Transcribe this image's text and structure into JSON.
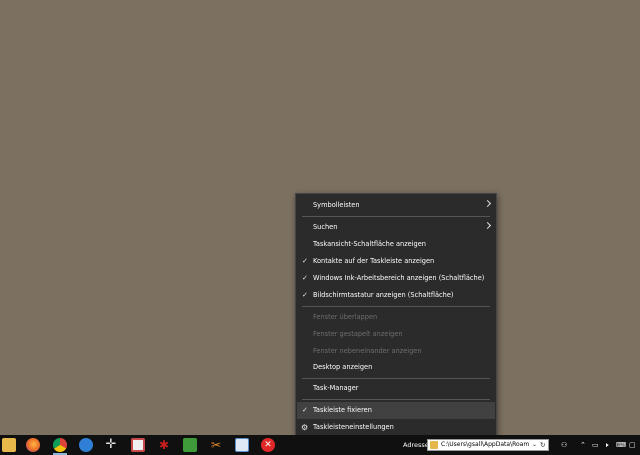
{
  "desktop": {
    "background_color": "#7c7060"
  },
  "context_menu": {
    "items": [
      {
        "label": "Symbolleisten",
        "submenu": true
      },
      {
        "label": "Suchen",
        "submenu": true
      },
      {
        "label": "Taskansicht-Schaltfläche anzeigen"
      },
      {
        "label": "Kontakte auf der Taskleiste anzeigen",
        "checked": true
      },
      {
        "label": "Windows Ink-Arbeitsbereich anzeigen (Schaltfläche)",
        "checked": true
      },
      {
        "label": "Bildschirmtastatur anzeigen (Schaltfläche)",
        "checked": true
      },
      {
        "label": "Fenster überlappen",
        "disabled": true
      },
      {
        "label": "Fenster gestapelt anzeigen",
        "disabled": true
      },
      {
        "label": "Fenster nebeneinander anzeigen",
        "disabled": true
      },
      {
        "label": "Desktop anzeigen"
      },
      {
        "label": "Task-Manager"
      },
      {
        "label": "Taskleiste fixieren",
        "checked": true,
        "highlighted": true
      },
      {
        "label": "Taskleisteneinstellungen",
        "icon": "gear-icon"
      }
    ]
  },
  "taskbar": {
    "pinned_icons": [
      {
        "name": "file-explorer-icon",
        "color": "#e8b84a"
      },
      {
        "name": "firefox-icon",
        "color": "#e86a2a"
      },
      {
        "name": "chrome-icon",
        "color": "#3aa35a"
      },
      {
        "name": "edge-icon",
        "color": "#2f7fd6"
      },
      {
        "name": "move-cross-icon",
        "color": "#e0e0e0"
      },
      {
        "name": "app-window-icon",
        "color": "#c94a4a"
      },
      {
        "name": "red-bug-icon",
        "color": "#c81e1e"
      },
      {
        "name": "green-document-icon",
        "color": "#3f9a3a"
      },
      {
        "name": "orange-scissors-icon",
        "color": "#e28a2a"
      },
      {
        "name": "text-document-icon",
        "color": "#5a8fd0"
      },
      {
        "name": "red-close-circle-icon",
        "color": "#e02828"
      }
    ],
    "address_label": "Adresse",
    "address_value": "C:\\Users\\gsall\\AppData\\Roamin",
    "tray": {
      "up_arrow_icon": "chevron-up-icon",
      "network_icon": "network-icon",
      "volume_icon": "volume-icon",
      "pen_icon": "pen-icon",
      "keyboard_icon": "keyboard-icon",
      "notification_icon": "notification-icon"
    }
  }
}
